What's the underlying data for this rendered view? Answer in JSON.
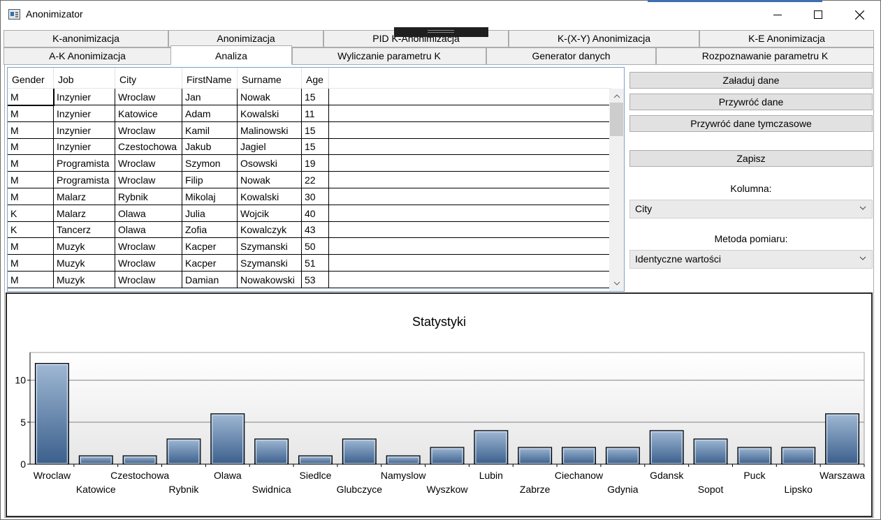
{
  "window": {
    "title": "Anonimizator"
  },
  "icons": {
    "app": "app-window-icon",
    "minimize": "minimize-icon",
    "maximize": "maximize-icon",
    "close": "close-icon"
  },
  "tabs_row1": [
    "K-anonimizacja",
    "Anonimizacja",
    "PID K-Anonimizacja",
    "K-(X-Y) Anonimizacja",
    "K-E Anonimizacja"
  ],
  "tabs_row2": [
    "A-K Anonimizacja",
    "Analiza",
    "Wyliczanie parametru K",
    "Generator danych",
    "Rozpoznawanie parametru K"
  ],
  "active_tab": "Analiza",
  "grid": {
    "columns": [
      "Gender",
      "Job",
      "City",
      "FirstName",
      "Surname",
      "Age"
    ],
    "rows": [
      [
        "M",
        "Inzynier",
        "Wroclaw",
        "Jan",
        "Nowak",
        "15"
      ],
      [
        "M",
        "Inzynier",
        "Katowice",
        "Adam",
        "Kowalski",
        "11"
      ],
      [
        "M",
        "Inzynier",
        "Wroclaw",
        "Kamil",
        "Malinowski",
        "15"
      ],
      [
        "M",
        "Inzynier",
        "Czestochowa",
        "Jakub",
        "Jagiel",
        "15"
      ],
      [
        "M",
        "Programista",
        "Wroclaw",
        "Szymon",
        "Osowski",
        "19"
      ],
      [
        "M",
        "Programista",
        "Wroclaw",
        "Filip",
        "Nowak",
        "22"
      ],
      [
        "M",
        "Malarz",
        "Rybnik",
        "Mikolaj",
        "Kowalski",
        "30"
      ],
      [
        "K",
        "Malarz",
        "Olawa",
        "Julia",
        "Wojcik",
        "40"
      ],
      [
        "K",
        "Tancerz",
        "Olawa",
        "Zofia",
        "Kowalczyk",
        "43"
      ],
      [
        "M",
        "Muzyk",
        "Wroclaw",
        "Kacper",
        "Szymanski",
        "50"
      ],
      [
        "M",
        "Muzyk",
        "Wroclaw",
        "Kacper",
        "Szymanski",
        "51"
      ],
      [
        "M",
        "Muzyk",
        "Wroclaw",
        "Damian",
        "Nowakowski",
        "53"
      ]
    ]
  },
  "buttons": {
    "load": "Załaduj dane",
    "restore": "Przywróć dane",
    "restore_temp": "Przywróć dane tymczasowe",
    "save": "Zapisz"
  },
  "column_select": {
    "label": "Kolumna:",
    "value": "City"
  },
  "method_select": {
    "label": "Metoda pomiaru:",
    "value": "Identyczne wartości"
  },
  "chart_data": {
    "type": "bar",
    "title": "Statystyki",
    "categories": [
      "Wroclaw",
      "Katowice",
      "Czestochowa",
      "Rybnik",
      "Olawa",
      "Swidnica",
      "Siedlce",
      "Glubczyce",
      "Namyslow",
      "Wyszkow",
      "Lubin",
      "Zabrze",
      "Ciechanow",
      "Gdynia",
      "Gdansk",
      "Sopot",
      "Puck",
      "Lipsko",
      "Warszawa"
    ],
    "values": [
      12,
      1,
      1,
      3,
      6,
      3,
      1,
      3,
      1,
      2,
      4,
      2,
      2,
      2,
      4,
      3,
      2,
      2,
      6
    ],
    "yticks": [
      0,
      5,
      10
    ],
    "ylim": [
      0,
      13.3
    ],
    "grid": true,
    "bar_color_top": "#9fb8d4",
    "bar_color_bottom": "#3b5f8c"
  }
}
